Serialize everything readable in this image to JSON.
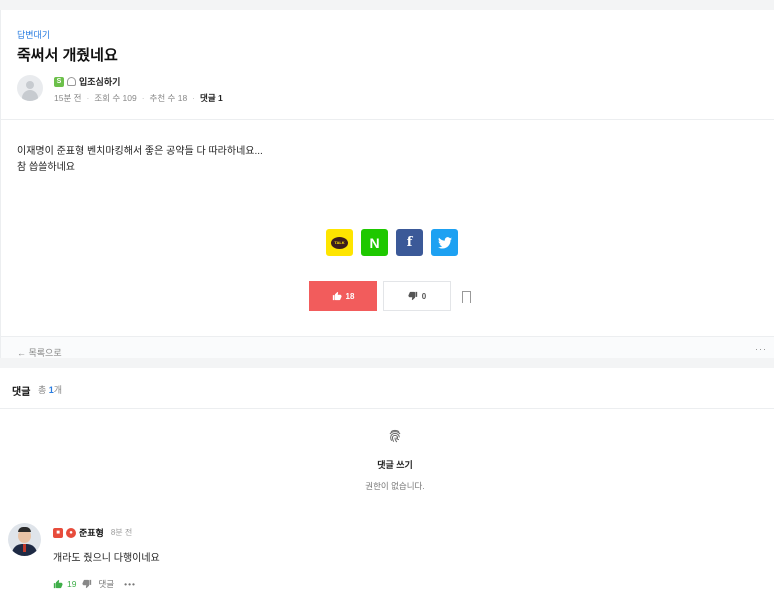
{
  "post": {
    "category": "답변대기",
    "title": "죽써서 개줬네요",
    "author": "입조심하기",
    "level_badge": "S",
    "meta": {
      "time": "15분 전",
      "views": "조회 수 109",
      "recommends": "추천 수 18",
      "comments": "댓글 1"
    },
    "body_lines": [
      "이재명이 준표형 벤치마킹해서 좋은 공약들 다 따라하네요...",
      "참 씁쓸하네요"
    ],
    "share": {
      "kakao": "TALK",
      "naver": "N",
      "facebook": "f",
      "twitter": "🐦"
    },
    "like_count": "18",
    "dislike_count": "0",
    "back_label": "← 목록으로",
    "more": "···"
  },
  "comments": {
    "title": "댓글",
    "count_prefix": "총 ",
    "count": "1",
    "count_suffix": "개",
    "write_label": "댓글 쓰기",
    "no_permission": "권한이 없습니다.",
    "items": [
      {
        "author": "준표형",
        "time": "8분 전",
        "text": "개라도 줬으니 다행이네요",
        "likes": "19",
        "reply_label": "댓글",
        "more": "•••"
      }
    ]
  },
  "colors": {
    "accent": "#2a7de1",
    "like": "#f25c5c",
    "kakao": "#fee500",
    "naver": "#1ec800",
    "facebook": "#3b5998",
    "twitter": "#1da1f2"
  }
}
